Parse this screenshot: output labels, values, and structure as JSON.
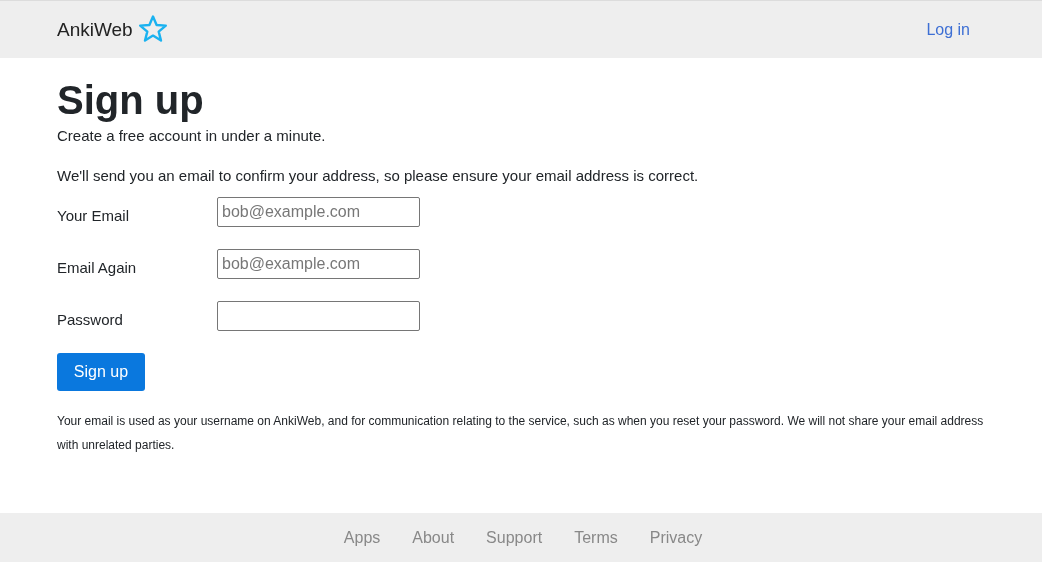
{
  "header": {
    "logo": "AnkiWeb",
    "login_link": "Log in"
  },
  "title": "Sign up",
  "intro": "Create a free account in under a minute.",
  "notice": "We'll send you an email to confirm your address, so please ensure your email address is correct.",
  "form": {
    "fields": [
      {
        "label": "Your Email",
        "placeholder": "bob@example.com"
      },
      {
        "label": "Email Again",
        "placeholder": "bob@example.com"
      },
      {
        "label": "Password"
      }
    ],
    "submit": "Sign up"
  },
  "privacy_note": "Your email is used as your username on AnkiWeb, and for communication relating to the service, such as when you reset your password. We will not share your email address with unrelated parties.",
  "footer": {
    "links": [
      "Apps",
      "About",
      "Support",
      "Terms",
      "Privacy"
    ]
  }
}
